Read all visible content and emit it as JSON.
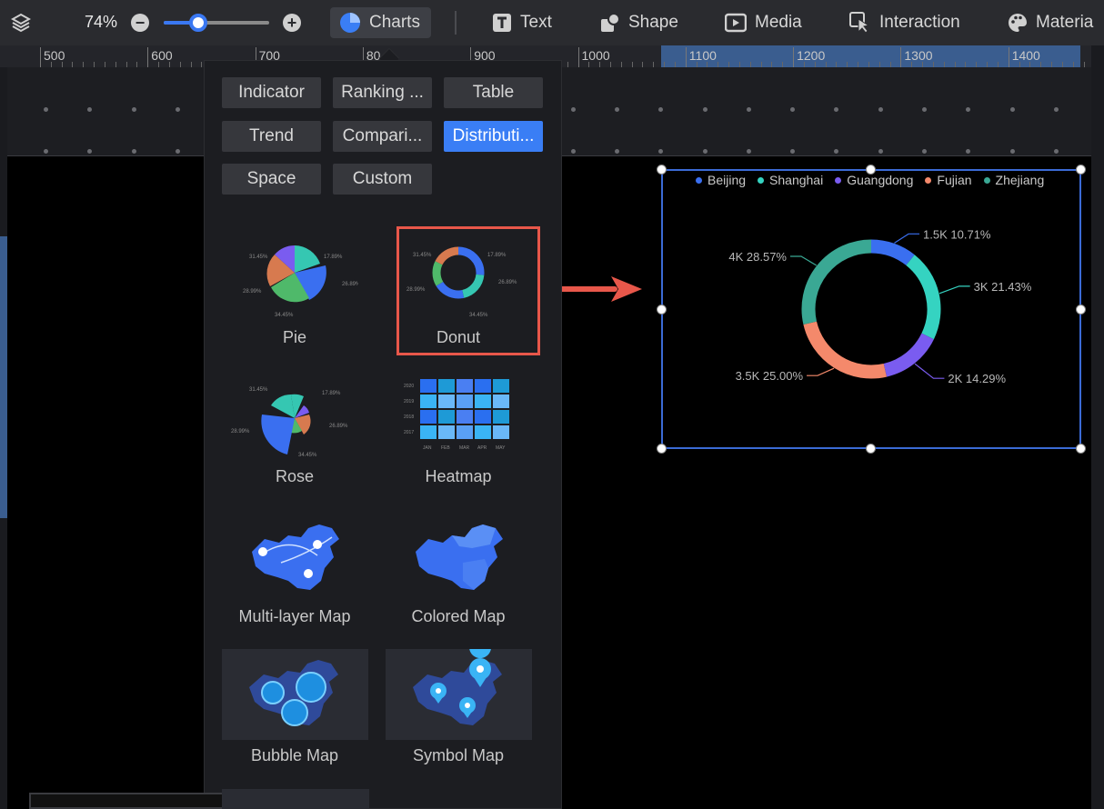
{
  "toolbar": {
    "zoom": "74%",
    "zoom_value": 0.74,
    "zoom_slider_fraction": 0.33,
    "tools": [
      {
        "label": "Charts",
        "icon": "pie-chart-icon",
        "active": true
      },
      {
        "label": "Text",
        "icon": "text-icon"
      },
      {
        "label": "Shape",
        "icon": "shape-icon"
      },
      {
        "label": "Media",
        "icon": "media-icon"
      },
      {
        "label": "Interaction",
        "icon": "interaction-icon"
      },
      {
        "label": "Materia",
        "icon": "palette-icon"
      }
    ]
  },
  "ruler": {
    "ticks": [
      "500",
      "600",
      "700",
      "80",
      "900",
      "1000",
      "1100",
      "1200",
      "1300",
      "1400"
    ]
  },
  "panel": {
    "categories": [
      {
        "label": "Indicator"
      },
      {
        "label": "Ranking ..."
      },
      {
        "label": "Table"
      },
      {
        "label": "Trend"
      },
      {
        "label": "Compari..."
      },
      {
        "label": "Distributi...",
        "active": true
      },
      {
        "label": "Space"
      },
      {
        "label": "Custom"
      }
    ],
    "charts": [
      {
        "label": "Pie"
      },
      {
        "label": "Donut",
        "highlighted": true
      },
      {
        "label": "Rose"
      },
      {
        "label": "Heatmap"
      },
      {
        "label": "Multi-layer Map"
      },
      {
        "label": "Colored Map"
      },
      {
        "label": "Bubble Map"
      },
      {
        "label": "Symbol Map"
      }
    ],
    "pie_thumb_labels": [
      "31.45%",
      "17.89%",
      "26.89%",
      "28.99%",
      "34.45%"
    ],
    "heatmap_thumb": {
      "rows": [
        "2020",
        "2019",
        "2018",
        "2017"
      ],
      "cols": [
        "JAN",
        "FEB",
        "MAR",
        "APR",
        "MAY"
      ]
    }
  },
  "chart_data": {
    "type": "pie",
    "variant": "donut",
    "title": "",
    "legend": [
      "Beijing",
      "Shanghai",
      "Guangdong",
      "Fujian",
      "Zhejiang"
    ],
    "legend_position": "top",
    "slices": [
      {
        "name": "Beijing",
        "value": 1500,
        "percent": 10.71,
        "label": "1.5K 10.71%",
        "color": "#3a6ff0"
      },
      {
        "name": "Shanghai",
        "value": 3000,
        "percent": 21.43,
        "label": "3K 21.43%",
        "color": "#35d3c1"
      },
      {
        "name": "Guangdong",
        "value": 2000,
        "percent": 14.29,
        "label": "2K 14.29%",
        "color": "#7a5cf0"
      },
      {
        "name": "Fujian",
        "value": 3500,
        "percent": 25.0,
        "label": "3.5K 25.00%",
        "color": "#f4896b"
      },
      {
        "name": "Zhejiang",
        "value": 4000,
        "percent": 28.57,
        "label": "4K 28.57%",
        "color": "#3aa894"
      }
    ]
  },
  "colors": {
    "accent": "#3a7ef5",
    "highlight": "#e8574a",
    "selection": "#3b6bd6"
  }
}
